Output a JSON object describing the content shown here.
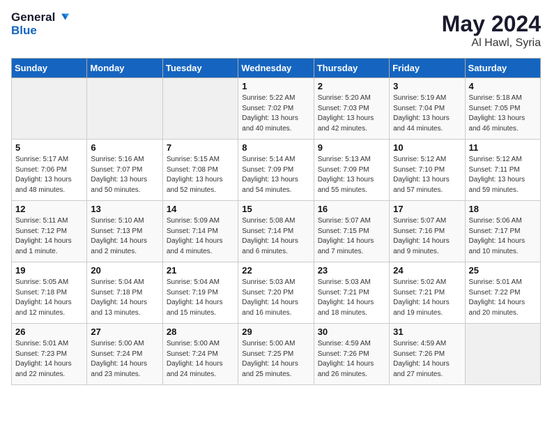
{
  "header": {
    "logo_line1": "General",
    "logo_line2": "Blue",
    "month_year": "May 2024",
    "location": "Al Hawl, Syria"
  },
  "weekdays": [
    "Sunday",
    "Monday",
    "Tuesday",
    "Wednesday",
    "Thursday",
    "Friday",
    "Saturday"
  ],
  "weeks": [
    [
      {
        "day": null
      },
      {
        "day": null
      },
      {
        "day": null
      },
      {
        "day": "1",
        "sunrise": "5:22 AM",
        "sunset": "7:02 PM",
        "daylight": "13 hours and 40 minutes."
      },
      {
        "day": "2",
        "sunrise": "5:20 AM",
        "sunset": "7:03 PM",
        "daylight": "13 hours and 42 minutes."
      },
      {
        "day": "3",
        "sunrise": "5:19 AM",
        "sunset": "7:04 PM",
        "daylight": "13 hours and 44 minutes."
      },
      {
        "day": "4",
        "sunrise": "5:18 AM",
        "sunset": "7:05 PM",
        "daylight": "13 hours and 46 minutes."
      }
    ],
    [
      {
        "day": "5",
        "sunrise": "5:17 AM",
        "sunset": "7:06 PM",
        "daylight": "13 hours and 48 minutes."
      },
      {
        "day": "6",
        "sunrise": "5:16 AM",
        "sunset": "7:07 PM",
        "daylight": "13 hours and 50 minutes."
      },
      {
        "day": "7",
        "sunrise": "5:15 AM",
        "sunset": "7:08 PM",
        "daylight": "13 hours and 52 minutes."
      },
      {
        "day": "8",
        "sunrise": "5:14 AM",
        "sunset": "7:09 PM",
        "daylight": "13 hours and 54 minutes."
      },
      {
        "day": "9",
        "sunrise": "5:13 AM",
        "sunset": "7:09 PM",
        "daylight": "13 hours and 55 minutes."
      },
      {
        "day": "10",
        "sunrise": "5:12 AM",
        "sunset": "7:10 PM",
        "daylight": "13 hours and 57 minutes."
      },
      {
        "day": "11",
        "sunrise": "5:12 AM",
        "sunset": "7:11 PM",
        "daylight": "13 hours and 59 minutes."
      }
    ],
    [
      {
        "day": "12",
        "sunrise": "5:11 AM",
        "sunset": "7:12 PM",
        "daylight": "14 hours and 1 minute."
      },
      {
        "day": "13",
        "sunrise": "5:10 AM",
        "sunset": "7:13 PM",
        "daylight": "14 hours and 2 minutes."
      },
      {
        "day": "14",
        "sunrise": "5:09 AM",
        "sunset": "7:14 PM",
        "daylight": "14 hours and 4 minutes."
      },
      {
        "day": "15",
        "sunrise": "5:08 AM",
        "sunset": "7:14 PM",
        "daylight": "14 hours and 6 minutes."
      },
      {
        "day": "16",
        "sunrise": "5:07 AM",
        "sunset": "7:15 PM",
        "daylight": "14 hours and 7 minutes."
      },
      {
        "day": "17",
        "sunrise": "5:07 AM",
        "sunset": "7:16 PM",
        "daylight": "14 hours and 9 minutes."
      },
      {
        "day": "18",
        "sunrise": "5:06 AM",
        "sunset": "7:17 PM",
        "daylight": "14 hours and 10 minutes."
      }
    ],
    [
      {
        "day": "19",
        "sunrise": "5:05 AM",
        "sunset": "7:18 PM",
        "daylight": "14 hours and 12 minutes."
      },
      {
        "day": "20",
        "sunrise": "5:04 AM",
        "sunset": "7:18 PM",
        "daylight": "14 hours and 13 minutes."
      },
      {
        "day": "21",
        "sunrise": "5:04 AM",
        "sunset": "7:19 PM",
        "daylight": "14 hours and 15 minutes."
      },
      {
        "day": "22",
        "sunrise": "5:03 AM",
        "sunset": "7:20 PM",
        "daylight": "14 hours and 16 minutes."
      },
      {
        "day": "23",
        "sunrise": "5:03 AM",
        "sunset": "7:21 PM",
        "daylight": "14 hours and 18 minutes."
      },
      {
        "day": "24",
        "sunrise": "5:02 AM",
        "sunset": "7:21 PM",
        "daylight": "14 hours and 19 minutes."
      },
      {
        "day": "25",
        "sunrise": "5:01 AM",
        "sunset": "7:22 PM",
        "daylight": "14 hours and 20 minutes."
      }
    ],
    [
      {
        "day": "26",
        "sunrise": "5:01 AM",
        "sunset": "7:23 PM",
        "daylight": "14 hours and 22 minutes."
      },
      {
        "day": "27",
        "sunrise": "5:00 AM",
        "sunset": "7:24 PM",
        "daylight": "14 hours and 23 minutes."
      },
      {
        "day": "28",
        "sunrise": "5:00 AM",
        "sunset": "7:24 PM",
        "daylight": "14 hours and 24 minutes."
      },
      {
        "day": "29",
        "sunrise": "5:00 AM",
        "sunset": "7:25 PM",
        "daylight": "14 hours and 25 minutes."
      },
      {
        "day": "30",
        "sunrise": "4:59 AM",
        "sunset": "7:26 PM",
        "daylight": "14 hours and 26 minutes."
      },
      {
        "day": "31",
        "sunrise": "4:59 AM",
        "sunset": "7:26 PM",
        "daylight": "14 hours and 27 minutes."
      },
      {
        "day": null
      }
    ]
  ],
  "labels": {
    "sunrise_prefix": "Sunrise: ",
    "sunset_prefix": "Sunset: ",
    "daylight_prefix": "Daylight: "
  }
}
